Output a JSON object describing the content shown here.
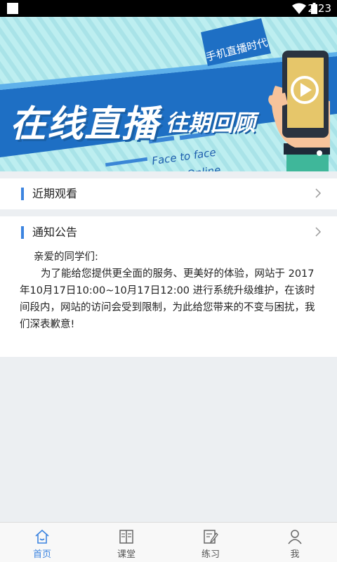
{
  "status_bar": {
    "time": "2:23",
    "icons": [
      "notification-square-icon",
      "wifi-icon",
      "battery-icon"
    ]
  },
  "banner": {
    "title": "在线直播",
    "subtitle": "往期回顾",
    "tag": "手机直播时代",
    "face_to_face": "Face to face",
    "online": "Online",
    "icons": [
      "play-icon"
    ]
  },
  "recent": {
    "title": "近期观看",
    "icons": [
      "chevron-right-icon"
    ]
  },
  "notice": {
    "title": "通知公告",
    "greeting": "亲爱的同学们:",
    "body": "为了能给您提供更全面的服务、更美好的体验，网站于 2017年10月17日10:00~10月17日12:00 进行系统升级维护，在该时间段内，网站的访问会受到限制，为此给您带来的不变与困扰，我们深表歉意!",
    "icons": [
      "chevron-right-icon"
    ]
  },
  "bottom_nav": {
    "items": [
      {
        "label": "首页",
        "icon": "home-icon",
        "active": true
      },
      {
        "label": "课堂",
        "icon": "book-icon",
        "active": false
      },
      {
        "label": "练习",
        "icon": "edit-icon",
        "active": false
      },
      {
        "label": "我",
        "icon": "user-icon",
        "active": false
      }
    ]
  },
  "colors": {
    "accent": "#3c84e0",
    "banner_bg": "#b9ecef",
    "banner_blue": "#1e6fc4",
    "page_bg": "#eceff2"
  }
}
